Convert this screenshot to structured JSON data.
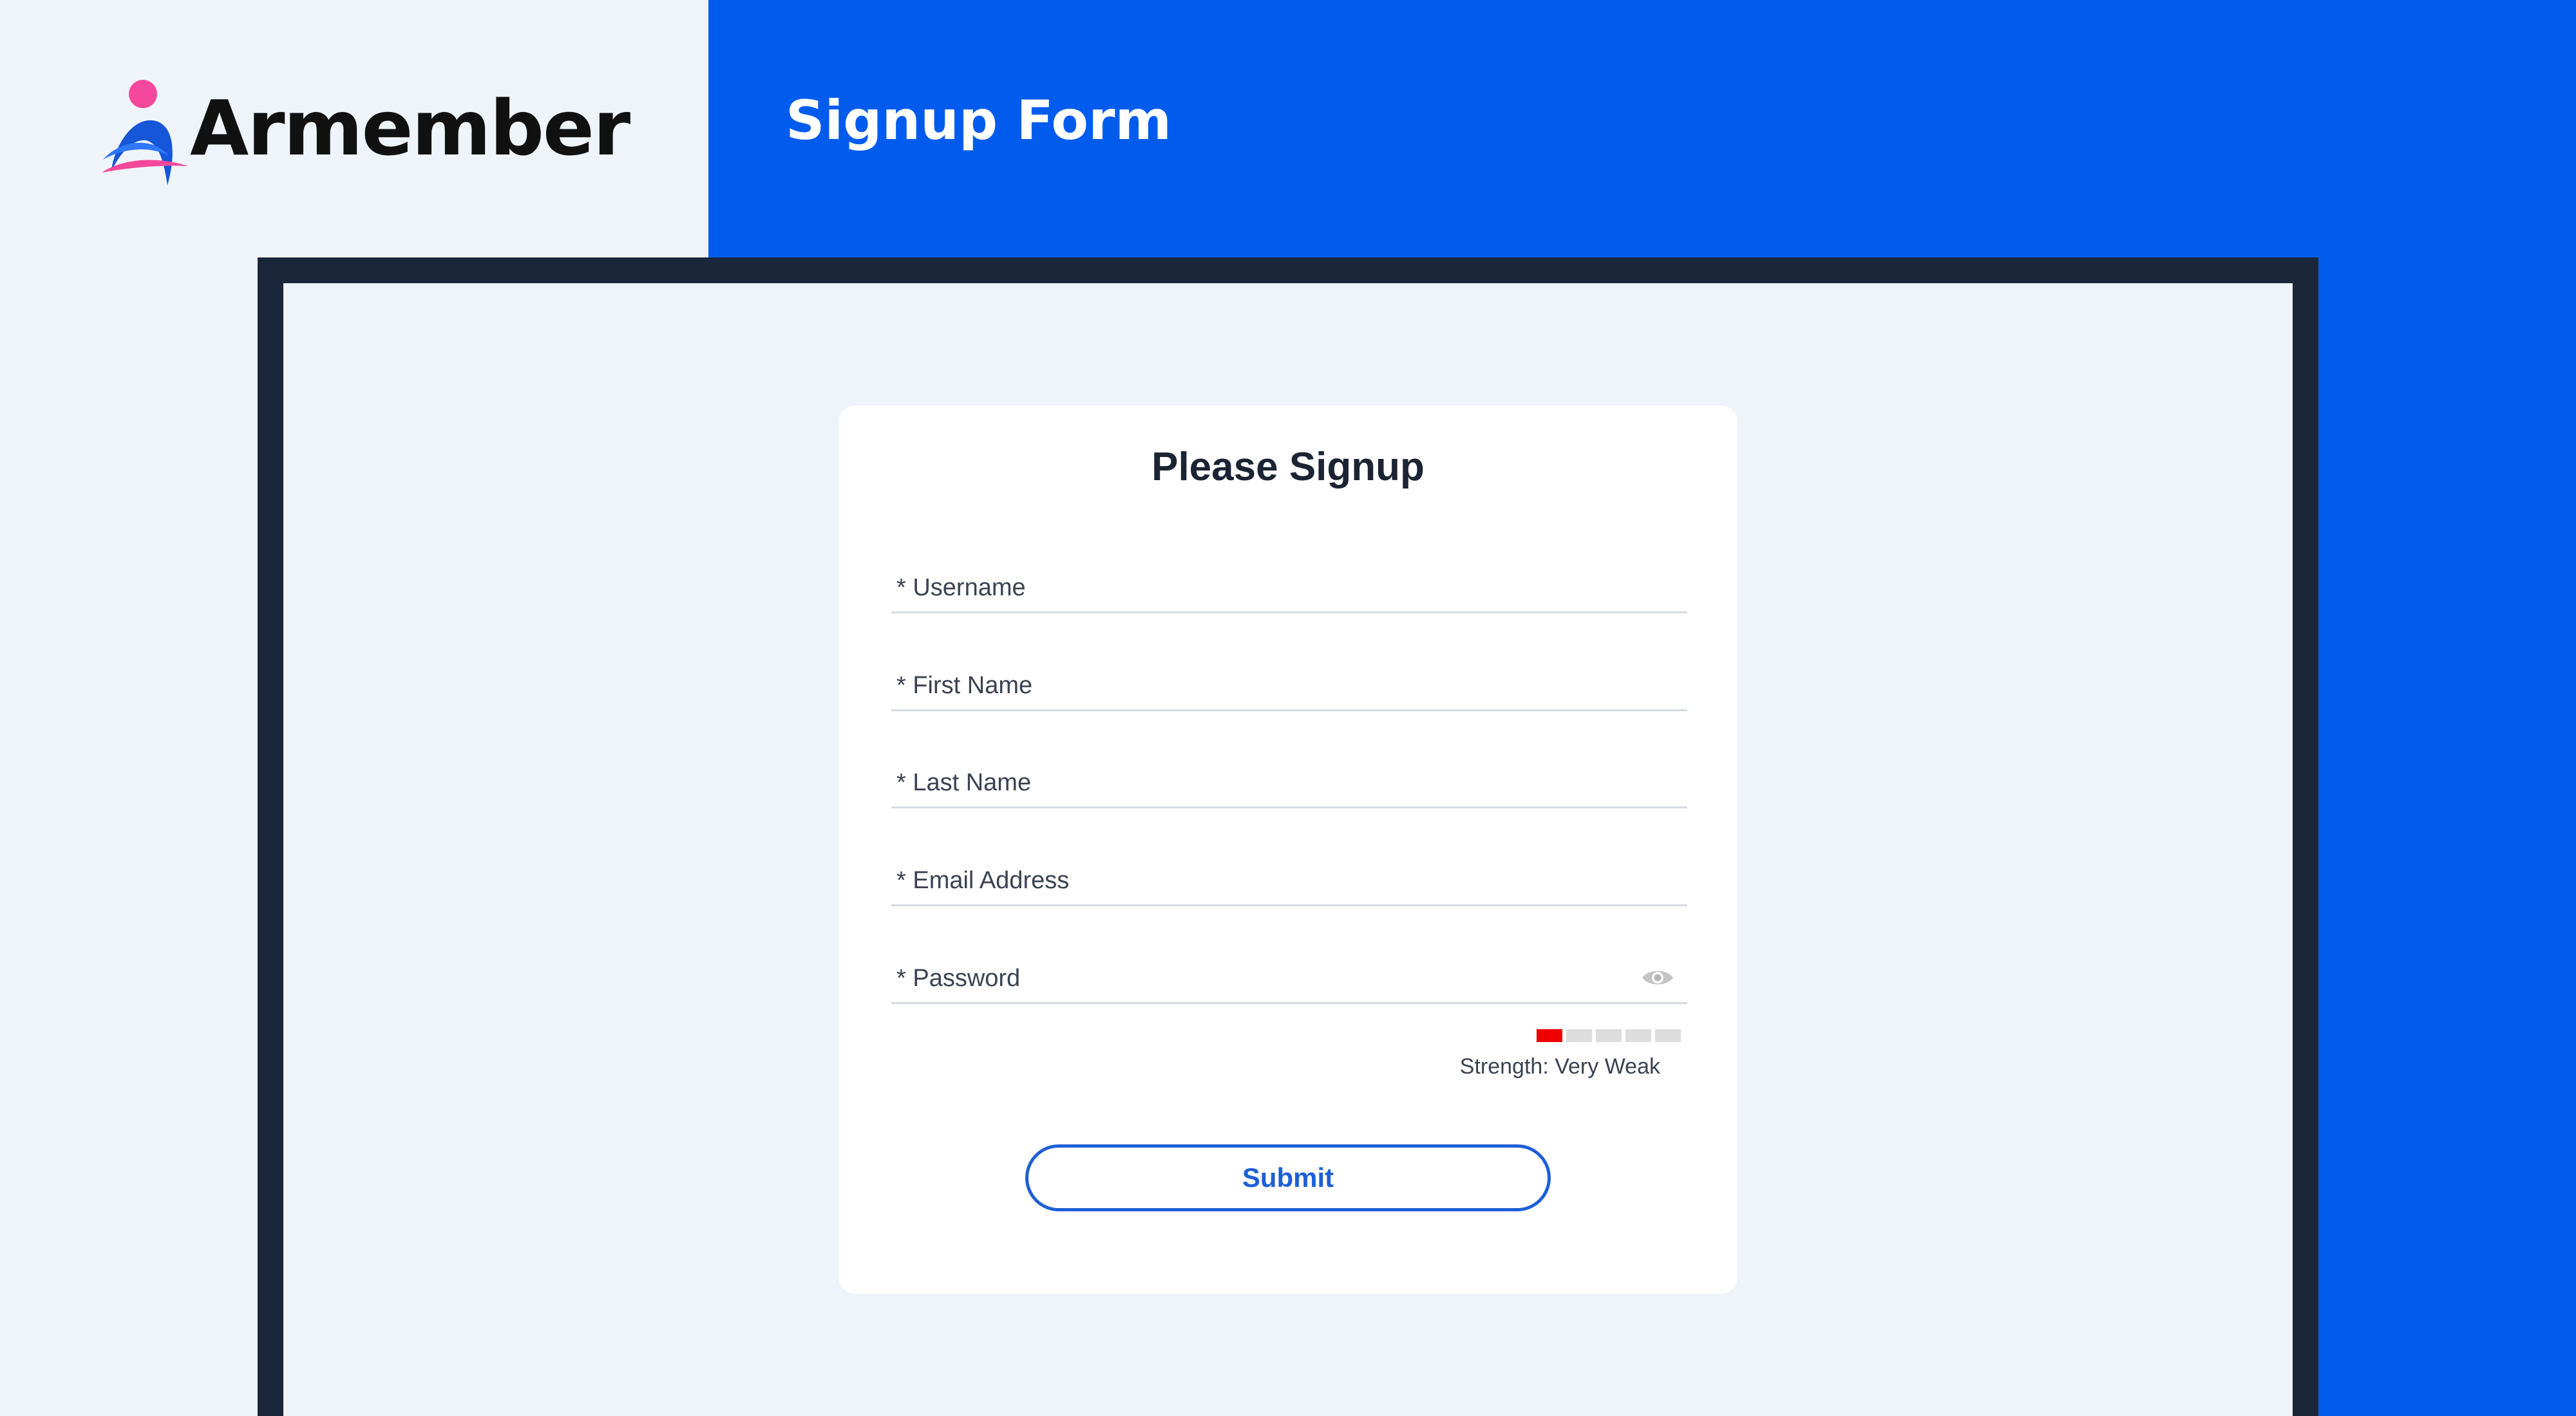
{
  "brand": {
    "name": "Armember"
  },
  "header": {
    "title": "Signup Form"
  },
  "form": {
    "title": "Please Signup",
    "fields": [
      {
        "label": "* Username"
      },
      {
        "label": "* First Name"
      },
      {
        "label": "* Last Name"
      },
      {
        "label": "* Email Address"
      },
      {
        "label": "* Password"
      }
    ],
    "password_strength": {
      "text": "Strength: Very Weak",
      "level": 1,
      "max": 5,
      "active_color": "#ee0000"
    },
    "submit_label": "Submit"
  },
  "colors": {
    "accent": "#015cee",
    "frame": "#1a2639",
    "button": "#1e5fd6",
    "logo_pink": "#f5489c",
    "logo_blue": "#1656d8"
  },
  "icons": {
    "password_toggle": "eye-icon"
  }
}
